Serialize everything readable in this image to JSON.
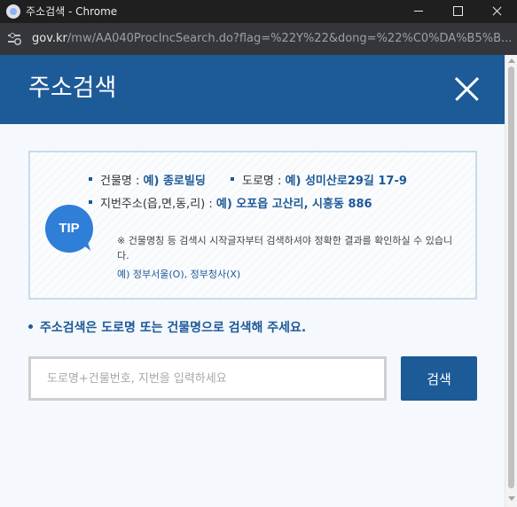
{
  "window": {
    "title": "주소검색 - Chrome"
  },
  "urlbar": {
    "host": "gov.kr",
    "path": "/mw/AA040ProcIncSearch.do?flag=%22Y%22&dong=%22%C0%DA%B5%B..."
  },
  "header": {
    "title": "주소검색"
  },
  "tip": {
    "badge": "TIP",
    "examples": [
      {
        "label": "건물명 : ",
        "value": "예) 종로빌딩"
      },
      {
        "label": "도로명 : ",
        "value": "예) 성미산로29길 17-9"
      },
      {
        "label": "지번주소(읍,면,동,리) : ",
        "value": "예) 오포읍 고산리, 시흥동 886"
      }
    ],
    "note": "※ 건물명칭 등 검색시 시작글자부터 검색하셔야 정확한 결과를 확인하실 수 있습니다.",
    "note_example": "예) 정부서울(O), 정부청사(X)"
  },
  "guide": {
    "text": "주소검색은 도로명 또는 건물명으로 검색해 주세요."
  },
  "search": {
    "value": "",
    "placeholder": "도로명+건물번호, 지번을 입력하세요",
    "button_label": "검색"
  },
  "colors": {
    "primary": "#1d5a98",
    "tip_badge": "#2f7ed8",
    "page_background": "#f5f8fc",
    "tip_border": "#c9dbea"
  }
}
